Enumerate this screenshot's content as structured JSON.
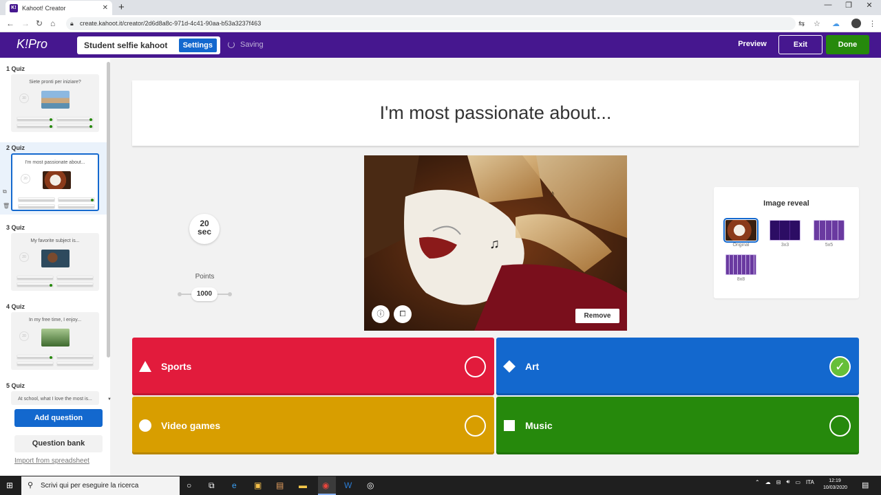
{
  "browser": {
    "tab_title": "Kahoot! Creator",
    "tab_close": "✕",
    "new_tab": "+",
    "url": "create.kahoot.it/creator/2d6d8a8c-971d-4c41-90aa-b53a3237f463",
    "window_controls": [
      "—",
      "❐",
      "✕"
    ]
  },
  "header": {
    "logo": "K!",
    "logo_suffix": "Pro",
    "kahoot_title": "Student selfie kahoot",
    "settings_label": "Settings",
    "status": "Saving",
    "preview_label": "Preview",
    "exit_label": "Exit",
    "done_label": "Done",
    "brand_color": "#46178f"
  },
  "sidebar": {
    "slides": [
      {
        "label": "1  Quiz",
        "question": "Siete pronti per iniziare?",
        "timer": "30"
      },
      {
        "label": "2  Quiz",
        "question": "I'm most passionate about...",
        "timer": "20"
      },
      {
        "label": "3  Quiz",
        "question": "My favorite subject is...",
        "timer": "20"
      },
      {
        "label": "4  Quiz",
        "question": "In my free time, I enjoy...",
        "timer": "20"
      },
      {
        "label": "5  Quiz",
        "question": "At school, what I love the most is..."
      }
    ],
    "add_question": "Add question",
    "question_bank": "Question bank",
    "import_link": "Import from spreadsheet"
  },
  "editor": {
    "question": "I'm most passionate about...",
    "timer_value": "20",
    "timer_unit": "sec",
    "points_label": "Points",
    "points_value": "1000",
    "remove_label": "Remove",
    "image_reveal": {
      "title": "Image reveal",
      "options": [
        "Original",
        "3x3",
        "5x5",
        "8x8"
      ],
      "selected": "Original"
    },
    "answers": [
      {
        "text": "Sports",
        "shape": "triangle-icon",
        "color": "#e21b3c",
        "correct": false
      },
      {
        "text": "Art",
        "shape": "diamond-icon",
        "color": "#1368ce",
        "correct": true
      },
      {
        "text": "Video games",
        "shape": "circle-icon",
        "color": "#d89e00",
        "correct": false
      },
      {
        "text": "Music",
        "shape": "square-icon",
        "color": "#26890c",
        "correct": false
      }
    ]
  },
  "taskbar": {
    "search_placeholder": "Scrivi qui per eseguire la ricerca",
    "language": "ITA",
    "time": "12:19",
    "date": "10/03/2020"
  }
}
